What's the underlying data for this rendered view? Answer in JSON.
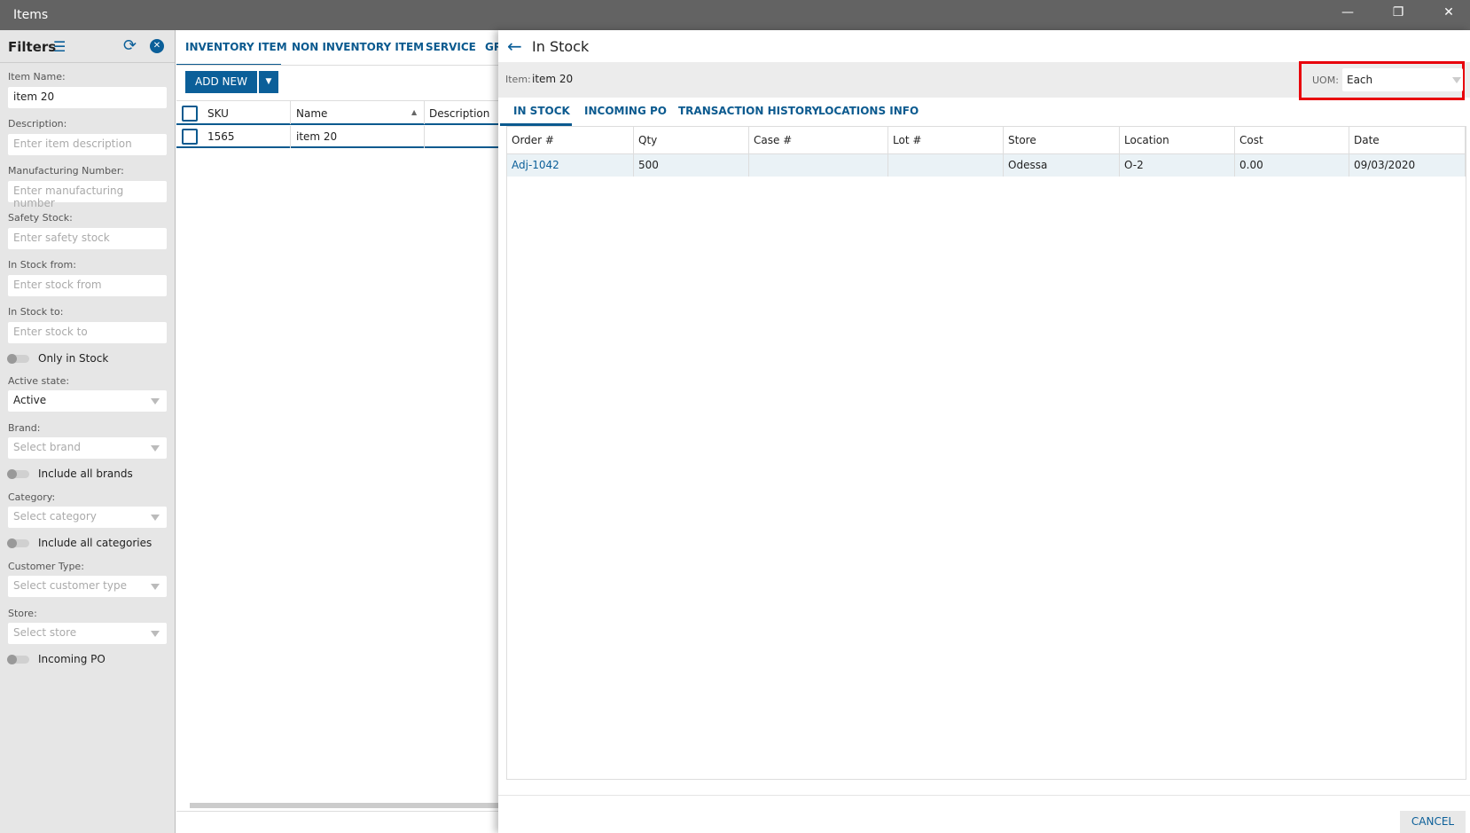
{
  "window": {
    "title": "Items"
  },
  "filters": {
    "title": "Filters",
    "item_name_label": "Item Name:",
    "item_name_value": "item 20",
    "description_label": "Description:",
    "description_placeholder": "Enter item description",
    "mfg_label": "Manufacturing Number:",
    "mfg_placeholder": "Enter manufacturing number",
    "safety_label": "Safety Stock:",
    "safety_placeholder": "Enter safety stock",
    "from_label": "In Stock from:",
    "from_placeholder": "Enter stock from",
    "to_label": "In Stock to:",
    "to_placeholder": "Enter stock to",
    "only_in_stock": "Only in Stock",
    "active_label": "Active state:",
    "active_value": "Active",
    "brand_label": "Brand:",
    "brand_placeholder": "Select brand",
    "include_brands": "Include all brands",
    "category_label": "Category:",
    "category_placeholder": "Select category",
    "include_categories": "Include all categories",
    "customer_label": "Customer Type:",
    "customer_placeholder": "Select customer type",
    "store_label": "Store:",
    "store_placeholder": "Select store",
    "incoming_po": "Incoming PO"
  },
  "items": {
    "tabs": [
      "INVENTORY ITEM",
      "NON INVENTORY ITEM",
      "SERVICE",
      "GR"
    ],
    "add_new": "ADD NEW",
    "columns": [
      "SKU",
      "Name",
      "Description"
    ],
    "rows": [
      {
        "sku": "1565",
        "name": "item 20",
        "description": ""
      }
    ]
  },
  "panel": {
    "title": "In Stock",
    "item_label": "Item:",
    "item_value": "item 20",
    "uom_label": "UOM:",
    "uom_value": "Each",
    "tabs": [
      "IN STOCK",
      "INCOMING PO",
      "TRANSACTION HISTORY",
      "LOCATIONS INFO"
    ],
    "columns": [
      "Order #",
      "Qty",
      "Case #",
      "Lot #",
      "Store",
      "Location",
      "Cost",
      "Date"
    ],
    "rows": [
      [
        "Adj-1042",
        "500",
        "",
        "",
        "Odessa",
        "O-2",
        "0.00",
        "09/03/2020"
      ]
    ],
    "cancel": "CANCEL"
  },
  "colors": {
    "accent": "#0b5f99",
    "highlight": "#e8000b"
  }
}
